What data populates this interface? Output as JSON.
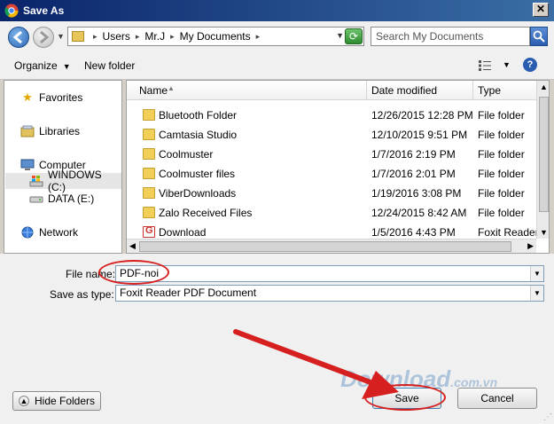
{
  "window": {
    "title": "Save As",
    "close_glyph": "✕"
  },
  "address": {
    "crumbs": [
      "Users",
      "Mr.J",
      "My Documents"
    ],
    "search_placeholder": "Search My Documents"
  },
  "toolbar": {
    "organize": "Organize",
    "new_folder": "New folder",
    "help": "?"
  },
  "nav": {
    "items": [
      {
        "label": "Favorites",
        "icon": "star-icon"
      },
      {
        "label": "Libraries",
        "icon": "libraries-icon"
      },
      {
        "label": "Computer",
        "icon": "computer-icon"
      },
      {
        "label": "WINDOWS (C:)",
        "icon": "drive-icon",
        "selected": true
      },
      {
        "label": "DATA (E:)",
        "icon": "drive-icon"
      },
      {
        "label": "Network",
        "icon": "network-icon"
      }
    ]
  },
  "files": {
    "headers": [
      "Name",
      "Date modified",
      "Type"
    ],
    "rows": [
      {
        "name": "Bluetooth Folder",
        "date": "12/26/2015 12:28 PM",
        "type": "File folder",
        "icon": "folder-icon"
      },
      {
        "name": "Camtasia Studio",
        "date": "12/10/2015 9:51 PM",
        "type": "File folder",
        "icon": "folder-icon"
      },
      {
        "name": "Coolmuster",
        "date": "1/7/2016 2:19 PM",
        "type": "File folder",
        "icon": "folder-icon"
      },
      {
        "name": "Coolmuster files",
        "date": "1/7/2016 2:01 PM",
        "type": "File folder",
        "icon": "folder-icon"
      },
      {
        "name": "ViberDownloads",
        "date": "1/19/2016 3:08 PM",
        "type": "File folder",
        "icon": "folder-icon"
      },
      {
        "name": "Zalo Received Files",
        "date": "12/24/2015 8:42 AM",
        "type": "File folder",
        "icon": "folder-icon"
      },
      {
        "name": "Download",
        "date": "1/5/2016 4:43 PM",
        "type": "Foxit Reader I",
        "icon": "pdf-icon"
      }
    ]
  },
  "form": {
    "file_name_label": "File name:",
    "file_name_value": "PDF-noi",
    "save_type_label": "Save as type:",
    "save_type_value": "Foxit Reader PDF Document"
  },
  "buttons": {
    "hide_folders": "Hide Folders",
    "save": "Save",
    "cancel": "Cancel"
  },
  "watermark": {
    "text": "Download",
    "suffix": ".com.vn"
  },
  "colors": {
    "annotation_red": "#d62020",
    "title_bar": "#0a246a"
  }
}
